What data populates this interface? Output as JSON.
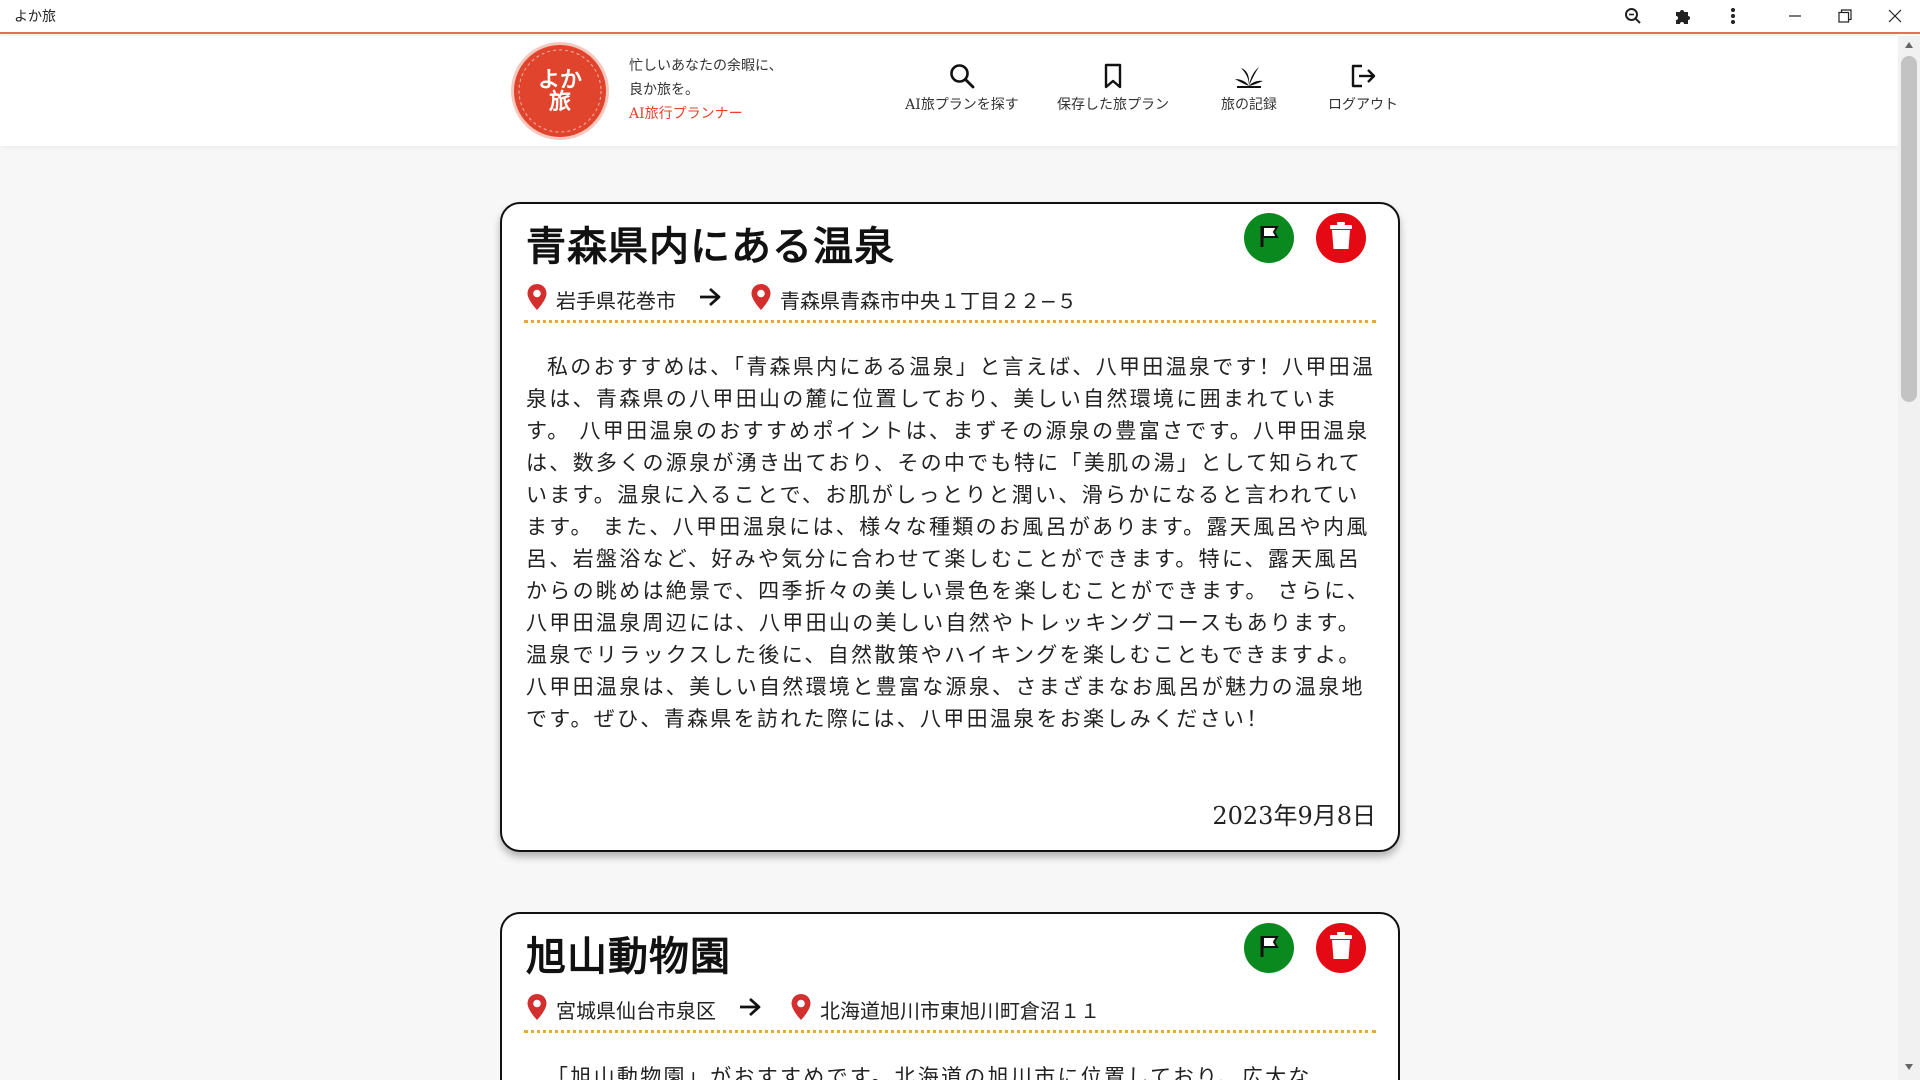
{
  "window": {
    "title": "よか旅",
    "buttons": [
      {
        "name": "zoom",
        "icon": "zoom-icon"
      },
      {
        "name": "extensions",
        "icon": "puzzle-icon"
      },
      {
        "name": "menu",
        "icon": "more-vertical-icon"
      },
      {
        "name": "minimize",
        "icon": "minimize-icon"
      },
      {
        "name": "restore",
        "icon": "restore-icon"
      },
      {
        "name": "close",
        "icon": "close-icon"
      }
    ]
  },
  "header": {
    "logo_line1": "よか",
    "logo_line2": "旅",
    "tagline_line1": "忙しいあなたの余暇に、",
    "tagline_line2": "良か旅を。",
    "tagline_accent": "AI旅行プランナー",
    "nav": [
      {
        "label": "AI旅プランを探す",
        "icon": "search-icon"
      },
      {
        "label": "保存した旅プラン",
        "icon": "bookmark-icon"
      },
      {
        "label": "旅の記録",
        "icon": "plant-icon"
      },
      {
        "label": "ログアウト",
        "icon": "logout-icon"
      }
    ]
  },
  "colors": {
    "brand_red": "#e0442d",
    "flag_green": "#0a8a1e",
    "delete_red": "#e50914",
    "divider_gold": "#e8a73b",
    "pin_red": "#d32f2f"
  },
  "plans": [
    {
      "title": "青森県内にある温泉",
      "from": "岩手県花巻市",
      "to": "青森県青森市中央１丁目２２−５",
      "body": "私のおすすめは、「青森県内にある温泉」と言えば、八甲田温泉です！八甲田温泉は、青森県の八甲田山の麓に位置しており、美しい自然環境に囲まれています。 八甲田温泉のおすすめポイントは、まずその源泉の豊富さです。八甲田温泉は、数多くの源泉が湧き出ており、その中でも特に「美肌の湯」として知られています。温泉に入ることで、お肌がしっとりと潤い、滑らかになると言われています。 また、八甲田温泉には、様々な種類のお風呂があります。露天風呂や内風呂、岩盤浴など、好みや気分に合わせて楽しむことができます。特に、露天風呂からの眺めは絶景で、四季折々の美しい景色を楽しむことができます。 さらに、八甲田温泉周辺には、八甲田山の美しい自然やトレッキングコースもあります。温泉でリラックスした後に、自然散策やハイキングを楽しむこともできますよ。 八甲田温泉は、美しい自然環境と豊富な源泉、さまざまなお風呂が魅力の温泉地です。ぜひ、青森県を訪れた際には、八甲田温泉をお楽しみください！",
      "date": "2023年9月8日"
    },
    {
      "title": "旭山動物園",
      "from": "宮城県仙台市泉区",
      "to": "北海道旭川市東旭川町倉沼１１",
      "body": "「旭山動物園」がおすすめです。北海道の旭川市に位置しており、広大な",
      "date": ""
    }
  ]
}
